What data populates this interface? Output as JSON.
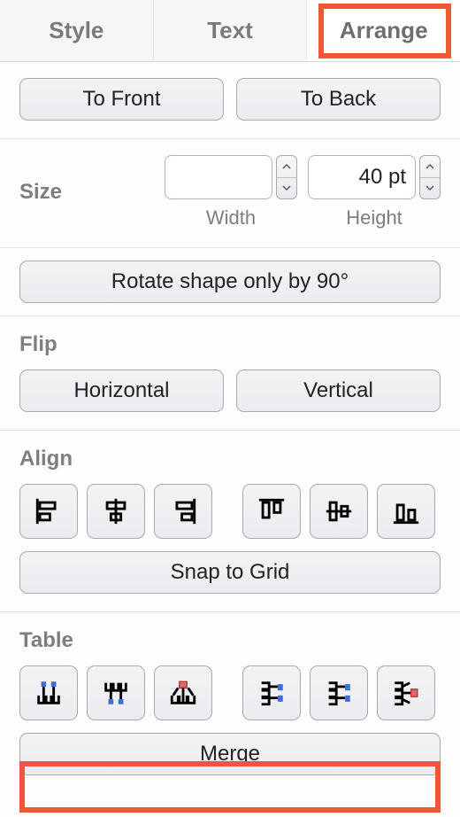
{
  "tabs": {
    "style": "Style",
    "text": "Text",
    "arrange": "Arrange"
  },
  "front_back": {
    "to_front": "To Front",
    "to_back": "To Back"
  },
  "size": {
    "label": "Size",
    "width_value": "",
    "height_value": "40 pt",
    "width_caption": "Width",
    "height_caption": "Height"
  },
  "rotate": {
    "button": "Rotate shape only by 90°"
  },
  "flip": {
    "label": "Flip",
    "horizontal": "Horizontal",
    "vertical": "Vertical"
  },
  "align": {
    "label": "Align",
    "snap": "Snap to Grid",
    "icons": [
      "align-left",
      "align-center-h",
      "align-right",
      "align-top",
      "align-center-v",
      "align-bottom"
    ]
  },
  "table": {
    "label": "Table",
    "merge": "Merge",
    "icons": [
      "insert-row-above",
      "insert-row-below",
      "delete-row",
      "insert-col-before",
      "insert-col-after",
      "delete-col"
    ]
  }
}
